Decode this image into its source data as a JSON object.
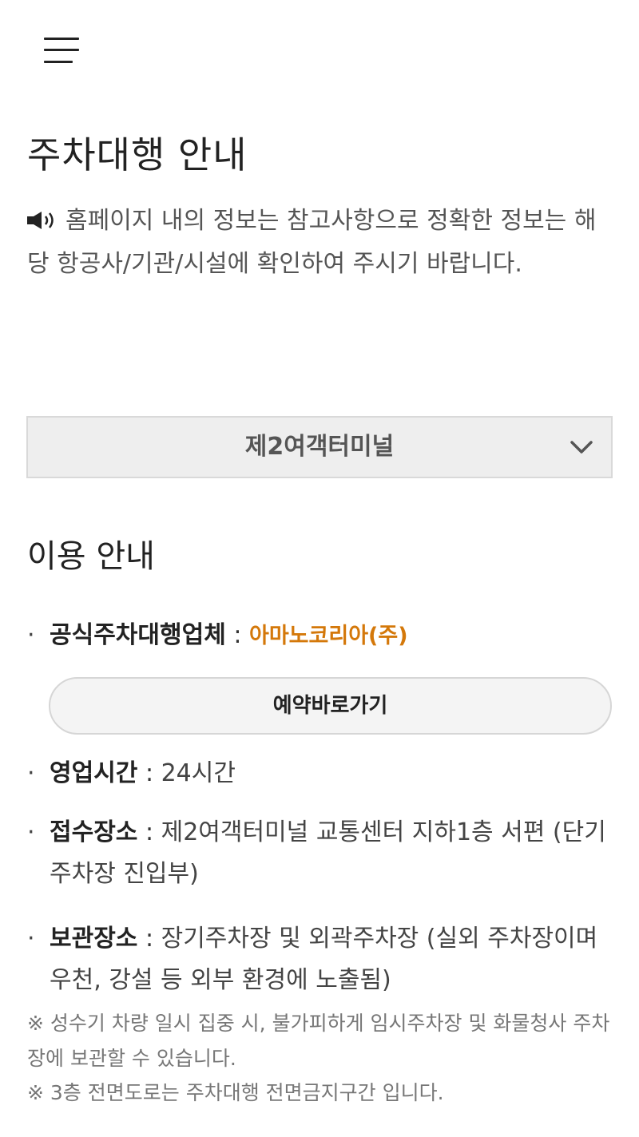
{
  "header": {
    "menu_icon": "hamburger-menu-icon"
  },
  "page": {
    "title": "주차대행 안내"
  },
  "notice": {
    "icon": "speaker-icon",
    "text": "홈페이지 내의 정보는 참고사항으로 정확한 정보는 해당 항공사/기관/시설에 확인하여 주시기 바랍니다."
  },
  "terminal_select": {
    "selected": "제2여객터미널",
    "icon": "chevron-down-icon"
  },
  "section": {
    "title": "이용 안내"
  },
  "items": {
    "bullet": "·",
    "operator": {
      "label": "공식주차대행업체",
      "sep": " : ",
      "value": "아마노코리아(주)"
    },
    "hours": {
      "label": "영업시간",
      "sep": " : ",
      "value": "24시간"
    },
    "reception": {
      "label": "접수장소",
      "sep": " : ",
      "value": "제2여객터미널 교통센터 지하1층 서편 (단기주차장 진입부)"
    },
    "storage": {
      "label": "보관장소",
      "sep": " : ",
      "value": "장기주차장 및 외곽주차장 (실외 주차장이며 우천, 강설 등 외부 환경에 노출됨)"
    }
  },
  "reserve_button": {
    "label": "예약바로가기"
  },
  "notes": {
    "peak": "※ 성수기 차량 일시 집중 시, 불가피하게 임시주차장 및 화물청사 주차장에 보관할 수 있습니다.",
    "restricted": "※ 3층 전면도로는 주차대행 전면금지구간 입니다."
  },
  "colors": {
    "accent_orange": "#d4780a",
    "select_bg": "#eeeeee",
    "button_bg": "#f4f4f4"
  }
}
